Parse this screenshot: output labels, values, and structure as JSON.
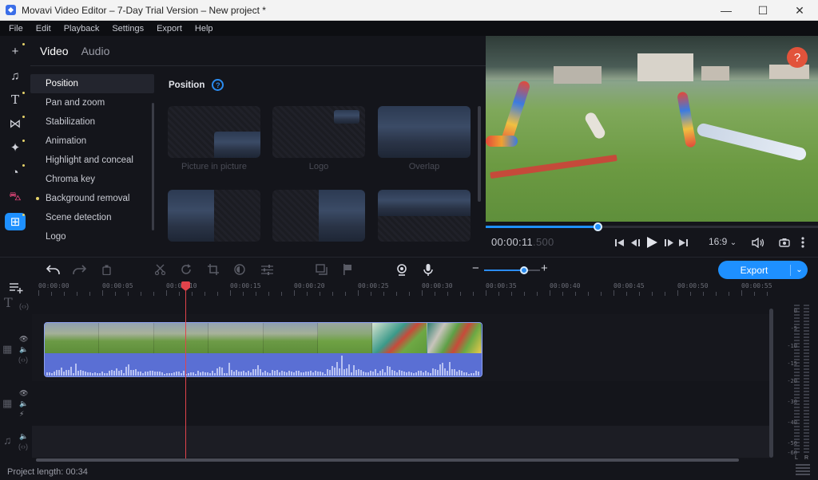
{
  "window": {
    "title": "Movavi Video Editor – 7-Day Trial Version – New project *",
    "controls": {
      "minimize": "—",
      "maximize": "☐",
      "close": "✕"
    }
  },
  "menu": [
    "File",
    "Edit",
    "Playback",
    "Settings",
    "Export",
    "Help"
  ],
  "toolstrip": [
    {
      "name": "import-icon",
      "glyph": "+",
      "dot": true
    },
    {
      "name": "music-icon",
      "glyph": "♫",
      "dot": false
    },
    {
      "name": "titles-icon",
      "glyph": "T",
      "dot": true
    },
    {
      "name": "transitions-icon",
      "glyph": "⋈",
      "dot": true
    },
    {
      "name": "effects-icon",
      "glyph": "✦",
      "dot": true
    },
    {
      "name": "stickers-icon",
      "glyph": "◔",
      "dot": true
    },
    {
      "name": "store-icon",
      "glyph": "⛍",
      "dot": false
    },
    {
      "name": "more-tools-icon",
      "glyph": "⊞",
      "dot": true
    }
  ],
  "filters": {
    "tabs": [
      {
        "label": "Video",
        "active": true
      },
      {
        "label": "Audio",
        "active": false
      }
    ],
    "categories": [
      {
        "label": "Position",
        "active": true,
        "dot": false
      },
      {
        "label": "Pan and zoom",
        "active": false,
        "dot": false
      },
      {
        "label": "Stabilization",
        "active": false,
        "dot": false
      },
      {
        "label": "Animation",
        "active": false,
        "dot": false
      },
      {
        "label": "Highlight and conceal",
        "active": false,
        "dot": false
      },
      {
        "label": "Chroma key",
        "active": false,
        "dot": false
      },
      {
        "label": "Background removal",
        "active": false,
        "dot": true
      },
      {
        "label": "Scene detection",
        "active": false,
        "dot": false
      },
      {
        "label": "Logo",
        "active": false,
        "dot": false
      }
    ],
    "content_title": "Position",
    "help_glyph": "?",
    "presets": [
      {
        "label": "Picture in picture"
      },
      {
        "label": "Logo"
      },
      {
        "label": "Overlap"
      },
      {
        "label": ""
      },
      {
        "label": ""
      },
      {
        "label": ""
      }
    ]
  },
  "preview": {
    "help_glyph": "?",
    "progress_fraction": 0.338,
    "timecode_main": "00:00:11",
    "timecode_ms": ".500",
    "aspect_ratio": "16:9",
    "aspect_arrow": "⌄"
  },
  "timeline_toolbar": {
    "zoom_level_fraction": 0.72,
    "zoom_minus": "−",
    "zoom_plus": "+",
    "export_label": "Export",
    "export_arrow": "⌄"
  },
  "ruler": {
    "labels": [
      "00:00:00",
      "00:00:05",
      "00:00:10",
      "00:00:15",
      "00:00:20",
      "00:00:25",
      "00:00:30",
      "00:00:35",
      "00:00:40",
      "00:00:45",
      "00:00:50",
      "00:00:55"
    ]
  },
  "meter": {
    "scale": [
      "0",
      "-5",
      "-10",
      "-15",
      "-20",
      "-30",
      "-40",
      "-50",
      "-60"
    ],
    "left_label": "L",
    "right_label": "R"
  },
  "status": {
    "project_length": "Project length: 00:34"
  }
}
